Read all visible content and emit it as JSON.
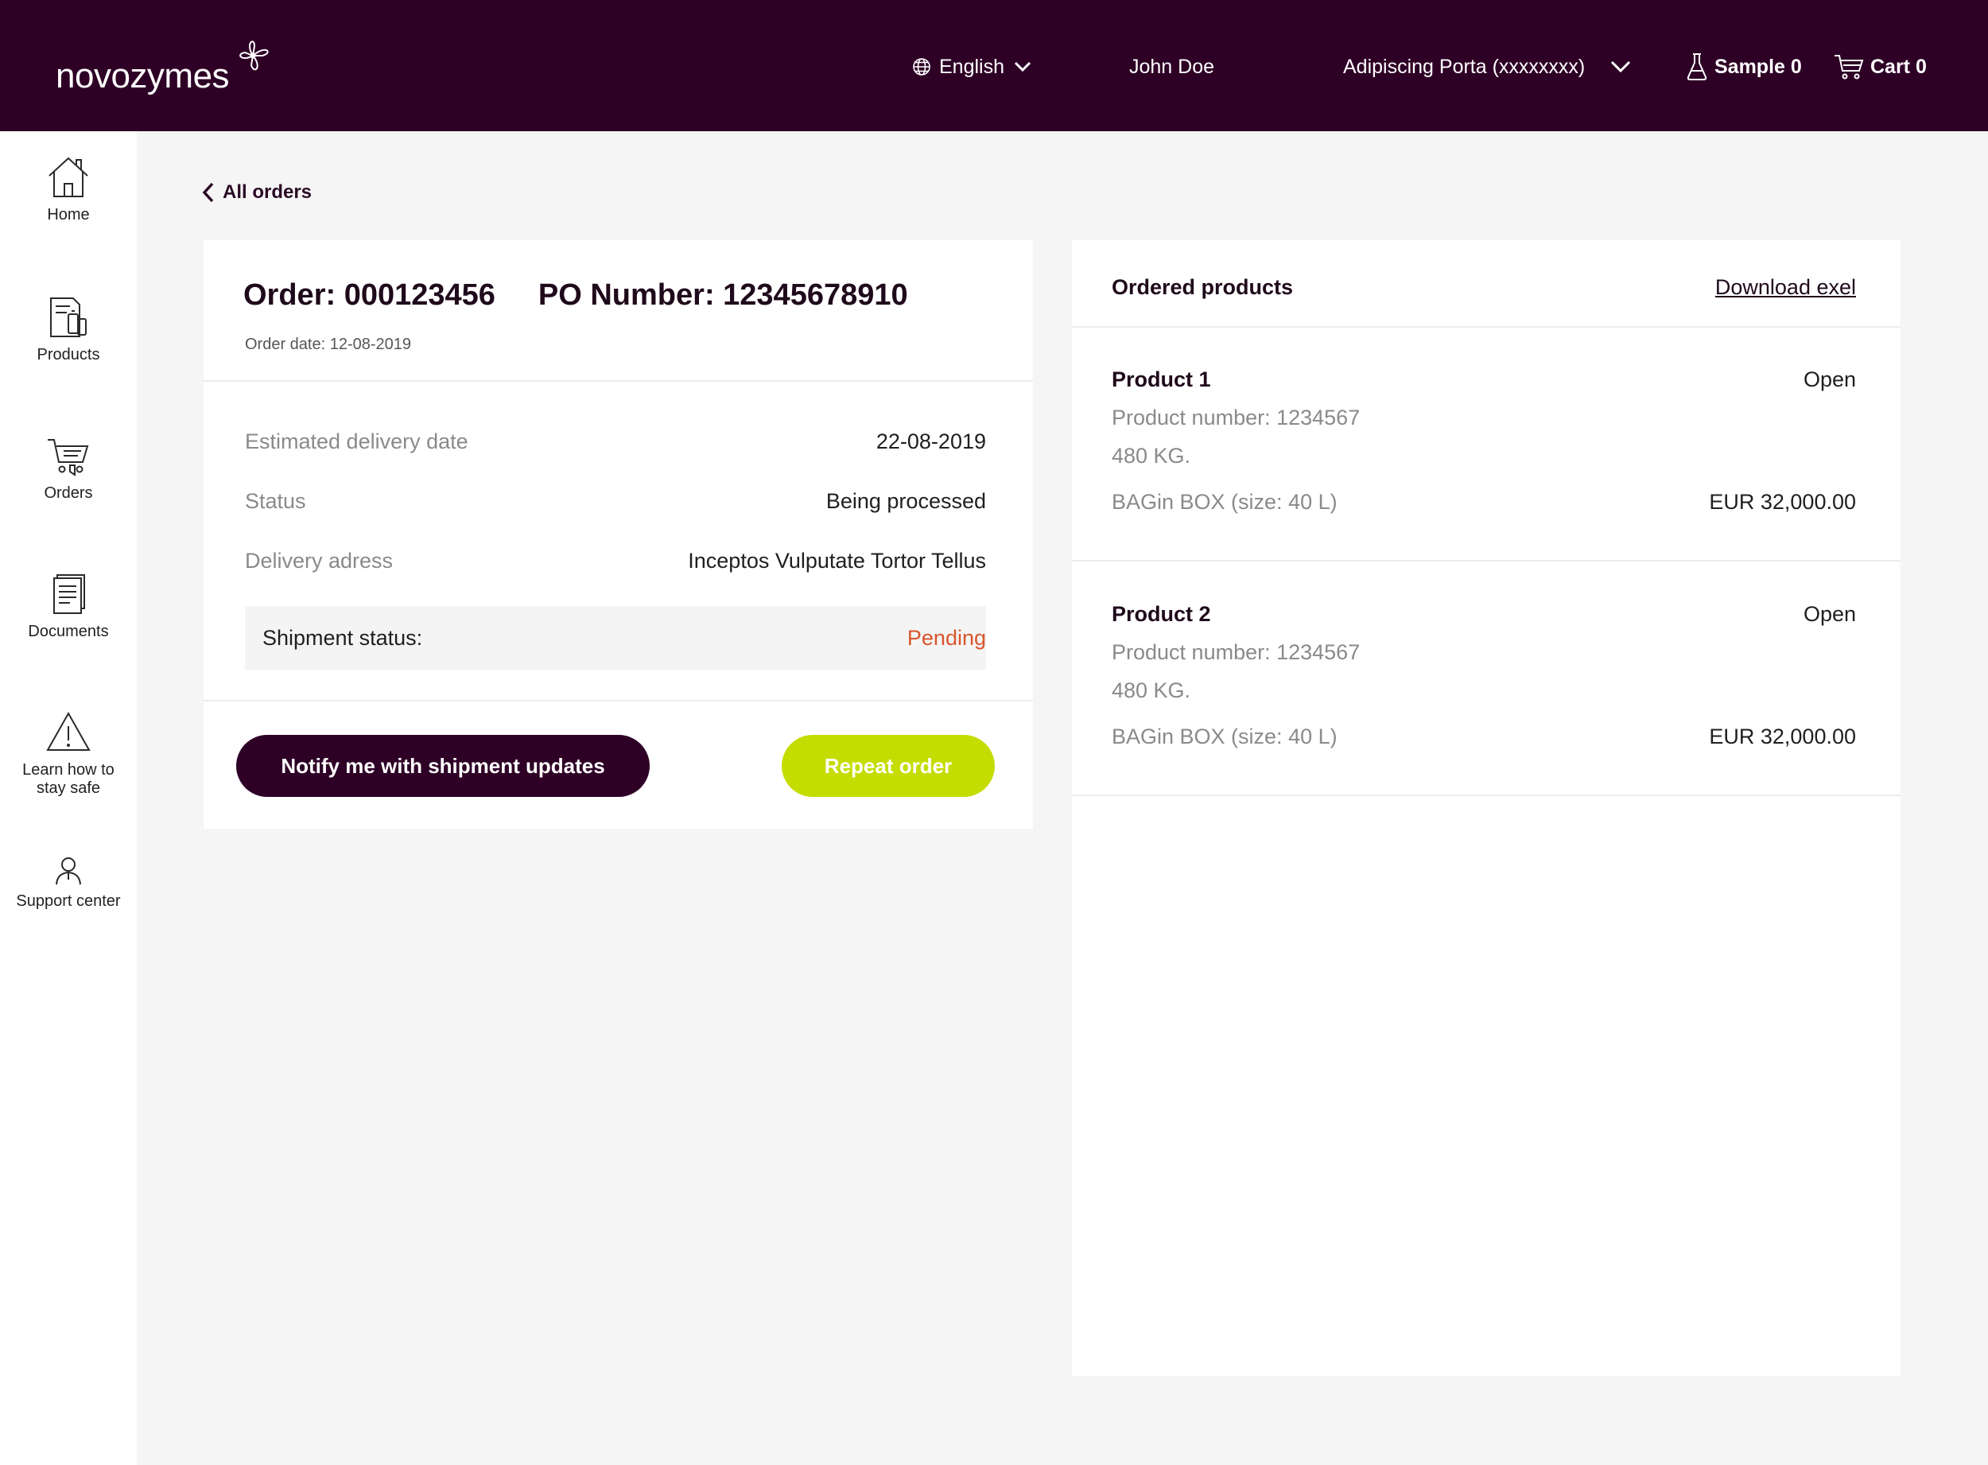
{
  "header": {
    "logo_text": "novozymes",
    "language": "English",
    "user": "John Doe",
    "account": "Adipiscing Porta (xxxxxxxx)",
    "sample_label": "Sample 0",
    "cart_label": "Cart 0"
  },
  "sidebar": {
    "items": [
      {
        "label": "Home",
        "icon": "home-icon"
      },
      {
        "label": "Products",
        "icon": "products-icon"
      },
      {
        "label": "Orders",
        "icon": "orders-cart-icon"
      },
      {
        "label": "Documents",
        "icon": "documents-icon"
      },
      {
        "label": "Learn how to stay safe",
        "label_line1": "Learn how to",
        "label_line2": "stay safe",
        "icon": "warning-icon"
      },
      {
        "label": "Support center",
        "icon": "support-person-icon"
      }
    ]
  },
  "nav": {
    "back_label": "All orders"
  },
  "order": {
    "order_label": "Order: 000123456",
    "po_label": "PO Number: 12345678910",
    "date_label": "Order date: 12-08-2019",
    "rows": [
      {
        "label": "Estimated delivery date",
        "value": "22-08-2019"
      },
      {
        "label": "Status",
        "value": "Being processed"
      },
      {
        "label": "Delivery adress",
        "value": "Inceptos Vulputate Tortor Tellus"
      }
    ],
    "shipment_label": "Shipment status:",
    "shipment_value": "Pending",
    "notify_button": "Notify me with shipment updates",
    "repeat_button": "Repeat order"
  },
  "products": {
    "title": "Ordered products",
    "download_label": "Download exel",
    "items": [
      {
        "name": "Product 1",
        "status": "Open",
        "number": "Product number: 1234567",
        "weight": "480 KG.",
        "package": "BAGin BOX (size: 40 L)",
        "price": "EUR 32,000.00"
      },
      {
        "name": "Product 2",
        "status": "Open",
        "number": "Product number: 1234567",
        "weight": "480 KG.",
        "package": "BAGin BOX (size: 40 L)",
        "price": "EUR 32,000.00"
      }
    ]
  },
  "colors": {
    "brand": "#2e0026",
    "accent_lime": "#c5dc00",
    "pending": "#d9552b"
  }
}
